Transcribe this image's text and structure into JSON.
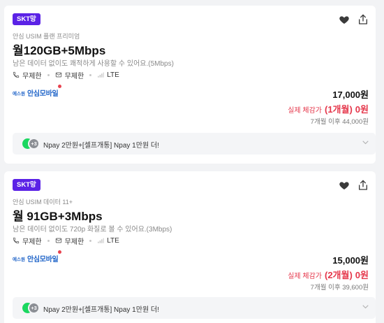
{
  "plans": [
    {
      "carrier_badge": "SKT망",
      "subtitle": "안심 USIM 플랜 프리미엄",
      "title": "월120GB+5Mbps",
      "description": "남은 데이터 없이도 쾌적하게 사용할 수 있어요.(5Mbps)",
      "calls": "무제한",
      "sms": "무제한",
      "network": "LTE",
      "brand_small": "에스원",
      "brand_name": "안심모바일",
      "price": "17,000원",
      "real_label": "실제 체감가",
      "real_period": "(1개월)",
      "real_value": "0원",
      "after_price": "7개월 이후 44,000원",
      "promo_badge": "+3",
      "promo_text": "Npay 2만원+[셀프개통] Npay 1만원 더!"
    },
    {
      "carrier_badge": "SKT망",
      "subtitle": "안심 USIM 데이터 11+",
      "title": "월 91GB+3Mbps",
      "description": "남은 데이터 없이도 720p 화질로 볼 수 있어요.(3Mbps)",
      "calls": "무제한",
      "sms": "무제한",
      "network": "LTE",
      "brand_small": "에스원",
      "brand_name": "안심모바일",
      "price": "15,000원",
      "real_label": "실제 체감가",
      "real_period": "(2개월)",
      "real_value": "0원",
      "after_price": "7개월 이후 39,600원",
      "promo_badge": "+3",
      "promo_text": "Npay 2만원+[셀프개통] Npay 1만원 더!"
    }
  ],
  "icons": {
    "heart": "heart-icon",
    "share": "share-icon",
    "phone": "phone-icon",
    "message": "message-icon",
    "signal": "signal-icon",
    "npay": "npay-icon",
    "chevron": "chevron-down-icon"
  },
  "colors": {
    "carrier_badge": "#5b22e6",
    "highlight_price": "#e5364a",
    "npay_green": "#1bd760",
    "brand_blue": "#1e63c8"
  }
}
